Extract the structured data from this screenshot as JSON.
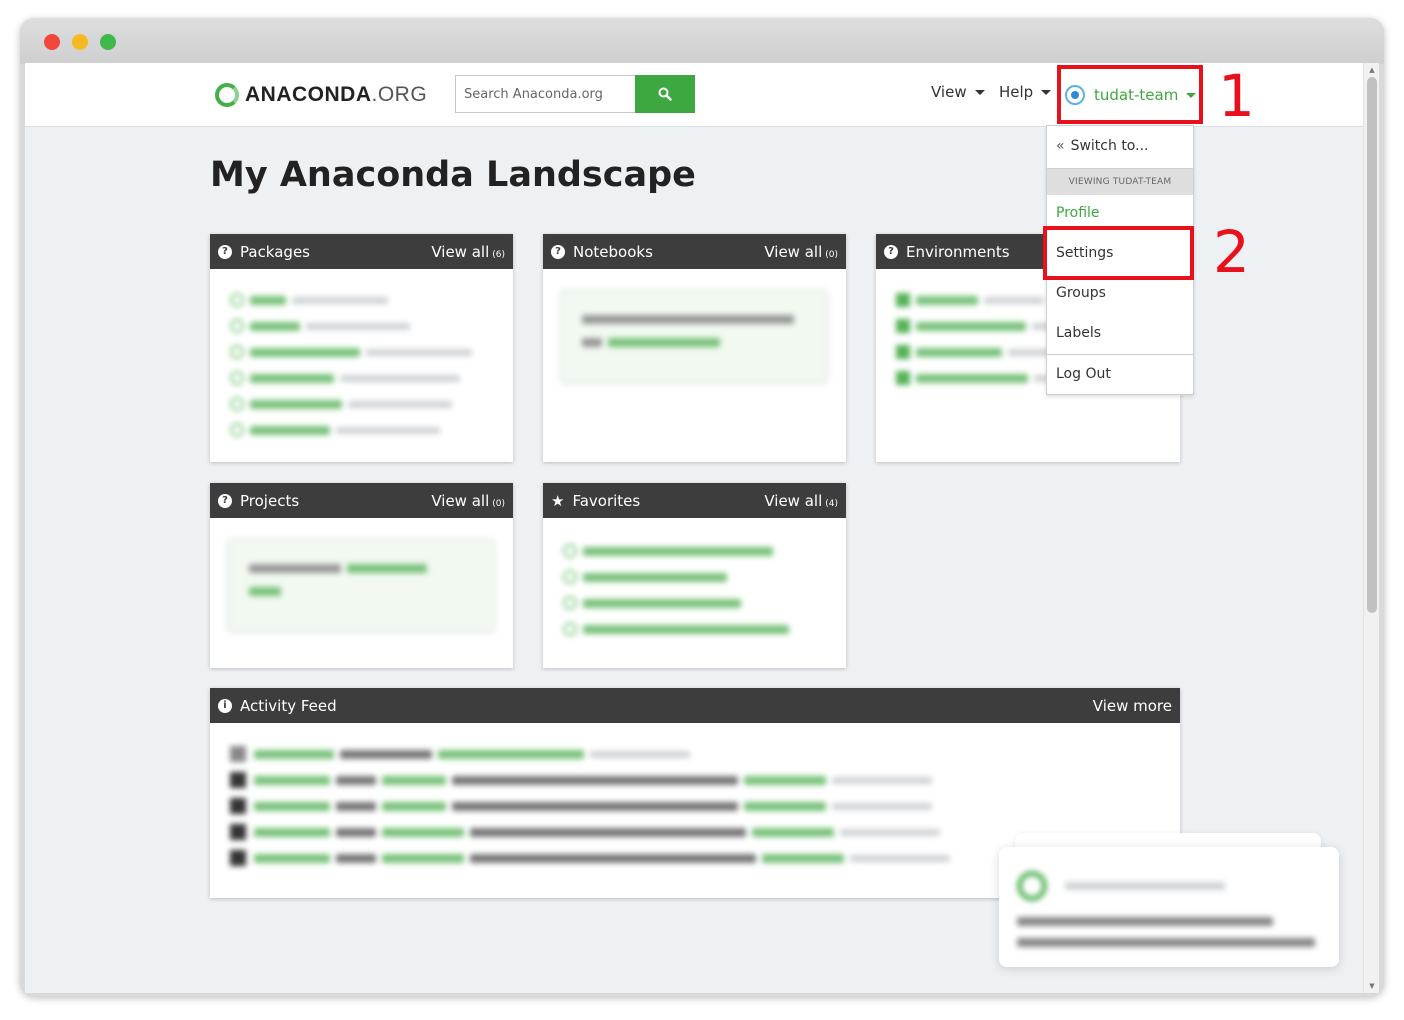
{
  "brand": {
    "name_bold": "ANACONDA",
    "name_light": ".ORG"
  },
  "search": {
    "placeholder": "Search Anaconda.org"
  },
  "nav": {
    "view": "View",
    "help": "Help"
  },
  "user": {
    "name": "tudat-team"
  },
  "dropdown": {
    "switch_to": "Switch to...",
    "viewing_header": "VIEWING TUDAT-TEAM",
    "profile": "Profile",
    "settings": "Settings",
    "groups": "Groups",
    "labels": "Labels",
    "log_out": "Log Out"
  },
  "annotations": {
    "step1": "1",
    "step2": "2"
  },
  "page_title": "My Anaconda Landscape",
  "cards": {
    "packages": {
      "title": "Packages",
      "view_all": "View all",
      "count": "(6)"
    },
    "notebooks": {
      "title": "Notebooks",
      "view_all": "View all",
      "count": "(0)"
    },
    "environments": {
      "title": "Environments"
    },
    "projects": {
      "title": "Projects",
      "view_all": "View all",
      "count": "(0)"
    },
    "favorites": {
      "title": "Favorites",
      "view_all": "View all",
      "count": "(4)"
    },
    "activity": {
      "title": "Activity Feed",
      "view_more": "View more"
    }
  },
  "colors": {
    "accent_green": "#3ca83f",
    "header_dark": "#3d3d3d",
    "annotation_red": "#e8101a"
  }
}
